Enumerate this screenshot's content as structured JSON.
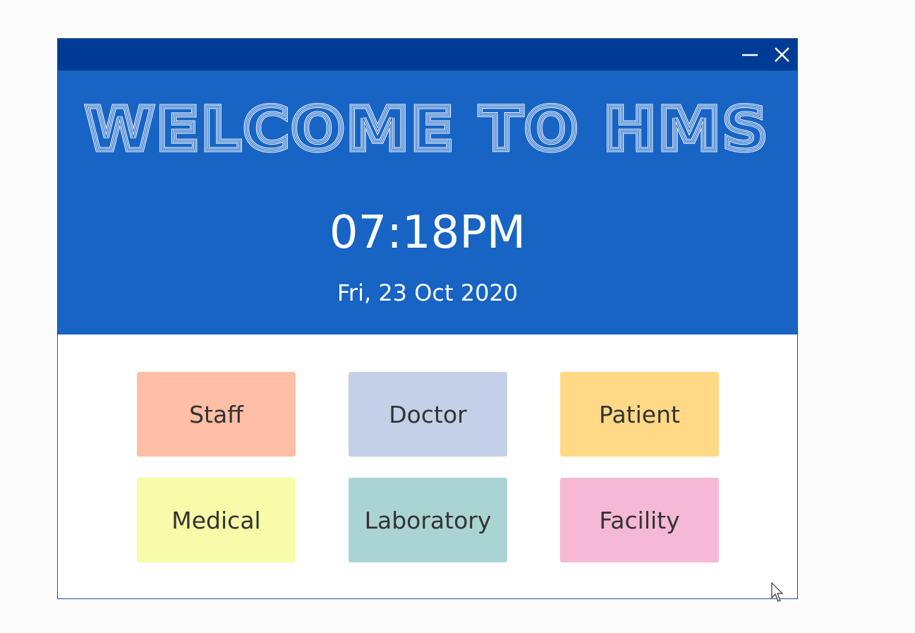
{
  "window": {
    "minimize_icon": "minimize-icon",
    "close_icon": "close-icon",
    "titlebar_color": "#003c96"
  },
  "header": {
    "title": "Welcome to HMS",
    "time": "07:18PM",
    "date": "Fri, 23 Oct 2020",
    "background_color": "#1764c4"
  },
  "modules": [
    {
      "label": "Staff",
      "color": "#ffbfa6"
    },
    {
      "label": "Doctor",
      "color": "#c3d0e8"
    },
    {
      "label": "Patient",
      "color": "#ffd985"
    },
    {
      "label": "Medical",
      "color": "#f6fca7"
    },
    {
      "label": "Laboratory",
      "color": "#aad4d3"
    },
    {
      "label": "Facility",
      "color": "#f5b9d5"
    }
  ]
}
